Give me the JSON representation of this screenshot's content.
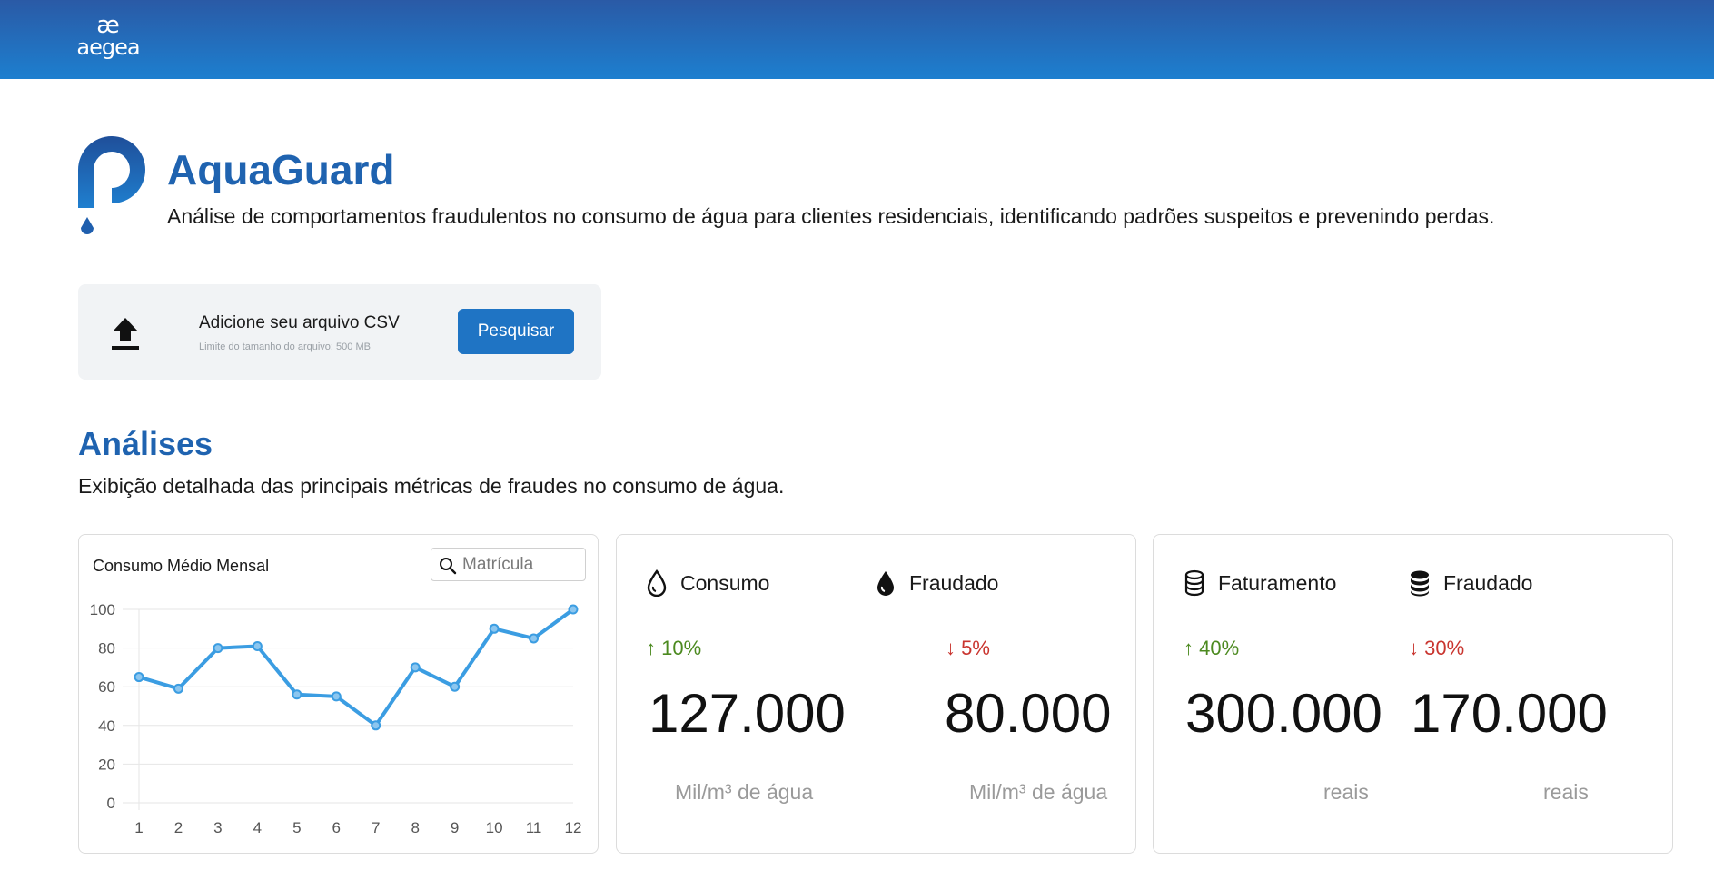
{
  "header": {
    "brand_mark": "æ",
    "brand_name": "aegea"
  },
  "app": {
    "title": "AquaGuard",
    "subtitle": "Análise de comportamentos fraudulentos no consumo de água para clientes residenciais, identificando padrões suspeitos e prevenindo perdas."
  },
  "upload": {
    "title": "Adicione seu arquivo CSV",
    "limit": "Limite do tamanho do arquivo: 500 MB",
    "button": "Pesquisar",
    "icon": "upload-icon"
  },
  "analyses": {
    "title": "Análises",
    "subtitle": "Exibição detalhada das principais métricas de fraudes no consumo de água."
  },
  "chart_card": {
    "title": "Consumo Médio Mensal",
    "search_placeholder": "Matrícula",
    "search_value": ""
  },
  "chart_data": {
    "type": "line",
    "title": "Consumo Médio Mensal",
    "xlabel": "",
    "ylabel": "",
    "x": [
      "1",
      "2",
      "3",
      "4",
      "5",
      "6",
      "7",
      "8",
      "9",
      "10",
      "11",
      "12"
    ],
    "series": [
      {
        "values": [
          65,
          59,
          80,
          81,
          56,
          55,
          40,
          70,
          60,
          90,
          85,
          100
        ]
      }
    ],
    "ylim": [
      0,
      100
    ],
    "yticks": [
      0,
      20,
      40,
      60,
      80,
      100
    ],
    "grid": true,
    "legend": "none",
    "color": "#3b9de2"
  },
  "metrics": {
    "consumo": {
      "label": "Consumo",
      "icon": "water-drop-outline-icon",
      "delta": "↑ 10%",
      "value": "127.000",
      "unit": "Mil/m³ de água"
    },
    "consumo_fraudado": {
      "label": "Fraudado",
      "icon": "water-drop-filled-icon",
      "delta": "↓ 5%",
      "value": "80.000",
      "unit": "Mil/m³ de água"
    },
    "faturamento": {
      "label": "Faturamento",
      "icon": "database-outline-icon",
      "delta": "↑ 40%",
      "value": "300.000",
      "unit": "reais"
    },
    "faturamento_fraudado": {
      "label": "Fraudado",
      "icon": "database-filled-icon",
      "delta": "↓ 30%",
      "value": "170.000",
      "unit": "reais"
    }
  },
  "colors": {
    "primary": "#1f63b0",
    "button": "#1f74c4",
    "up": "#4c8a20",
    "down": "#c9352f",
    "line": "#3b9de2"
  }
}
